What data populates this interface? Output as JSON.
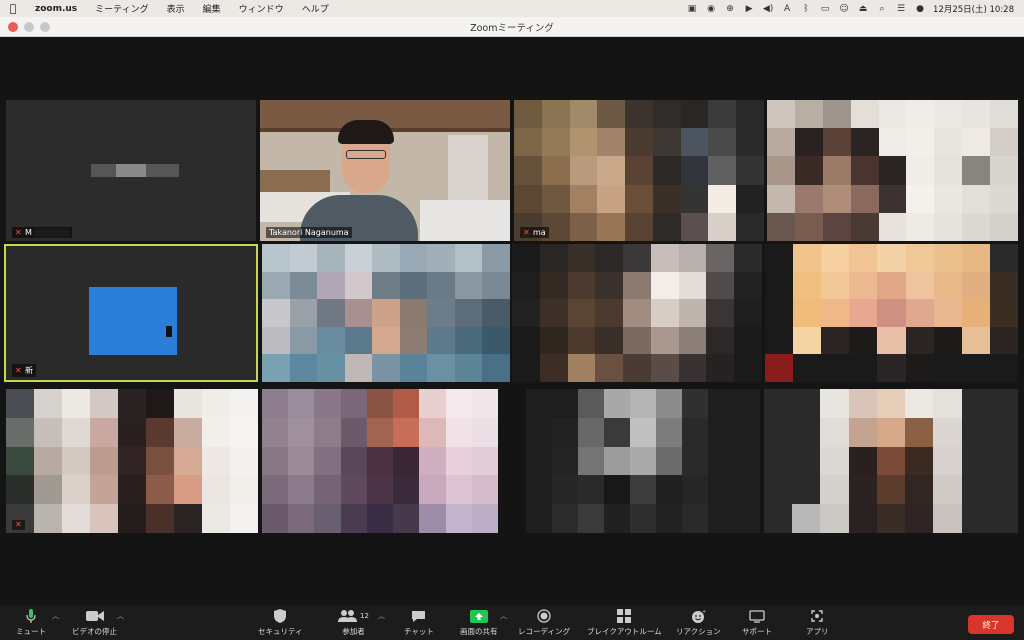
{
  "menubar": {
    "app": "zoom.us",
    "items": [
      "ミーティング",
      "表示",
      "編集",
      "ウィンドウ",
      "ヘルプ"
    ],
    "clock": "12月25日(土)  10:28"
  },
  "window": {
    "title": "Zoomミーティング"
  },
  "participants": [
    {
      "name": "M"
    },
    {
      "name": "Takanori Naganuma"
    },
    {
      "name": "ma"
    },
    {
      "name": ""
    },
    {
      "name": "新"
    },
    {
      "name": ""
    },
    {
      "name": ""
    },
    {
      "name": ""
    },
    {
      "name": ""
    },
    {
      "name": ""
    },
    {
      "name": ""
    },
    {
      "name": ""
    }
  ],
  "toolbar": {
    "mute": "ミュート",
    "video": "ビデオの停止",
    "security": "セキュリティ",
    "participants": "参加者",
    "participant_count": "12",
    "chat": "チャット",
    "share": "画面の共有",
    "record": "レコーディング",
    "breakout": "ブレイクアウトルーム",
    "reactions": "リアクション",
    "support": "サポート",
    "apps": "アプリ",
    "end": "終了"
  },
  "colors": {
    "share_green": "#23c552",
    "end_red": "#d9362b",
    "active_speaker": "#c6d651",
    "tile_blue": "#2b7fd8"
  }
}
